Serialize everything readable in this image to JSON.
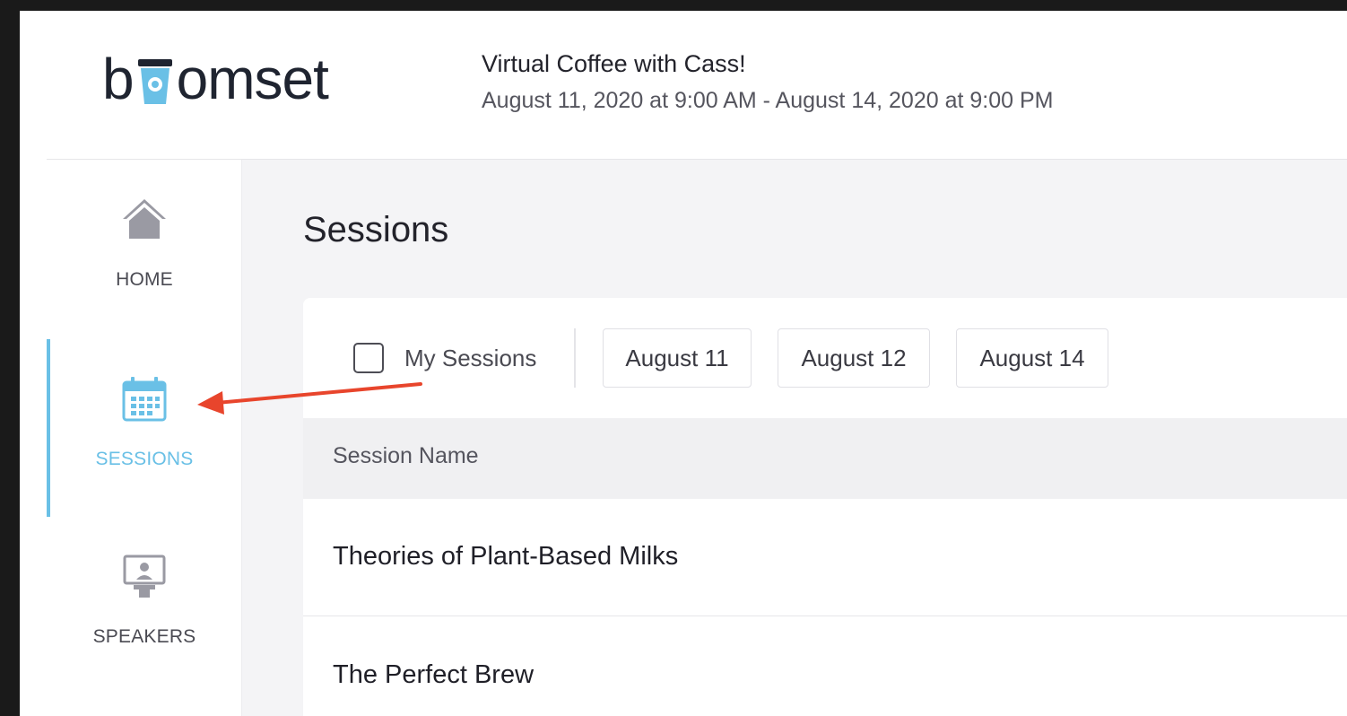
{
  "app": {
    "logo_text_start": "b",
    "logo_text_end": "omset",
    "logo_full": "boomset"
  },
  "event": {
    "title": "Virtual Coffee with Cass!",
    "dates": "August 11, 2020 at 9:00 AM - August 14, 2020 at 9:00 PM"
  },
  "sidebar": {
    "items": [
      {
        "label": "HOME",
        "icon": "home-icon",
        "active": false
      },
      {
        "label": "SESSIONS",
        "icon": "calendar-icon",
        "active": true
      },
      {
        "label": "SPEAKERS",
        "icon": "speaker-podium-icon",
        "active": false
      }
    ]
  },
  "page": {
    "title": "Sessions"
  },
  "filters": {
    "my_sessions_label": "My Sessions",
    "my_sessions_checked": false,
    "dates": [
      "August 11",
      "August 12",
      "August 14"
    ]
  },
  "table": {
    "columns": [
      "Session Name"
    ],
    "rows": [
      {
        "name": "Theories of Plant-Based Milks"
      },
      {
        "name": "The Perfect Brew"
      }
    ]
  },
  "colors": {
    "accent": "#6ac0e6",
    "annotation_arrow": "#e8452c",
    "background_dark": "#1a1a1a",
    "main_bg": "#f4f4f6"
  }
}
